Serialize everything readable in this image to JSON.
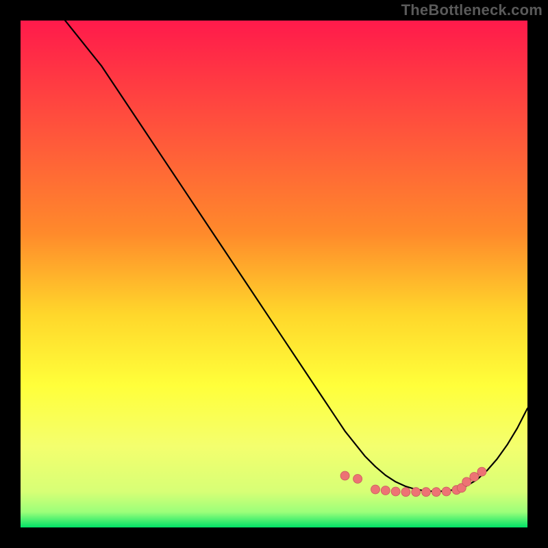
{
  "watermark": "TheBottleneck.com",
  "colors": {
    "gradient_top": "#ff1a4b",
    "gradient_mid1": "#ff8a2b",
    "gradient_mid2": "#ffd72b",
    "gradient_mid3": "#ffff3a",
    "gradient_mid4": "#f4ff6e",
    "gradient_bottom": "#00e267",
    "curve": "#000000",
    "marker_fill": "#ed7374",
    "marker_stroke": "#c55a5b",
    "black": "#000000"
  },
  "chart_data": {
    "type": "line",
    "title": "",
    "xlabel": "",
    "ylabel": "",
    "xlim": [
      0,
      100
    ],
    "ylim": [
      0,
      100
    ],
    "x": [
      0,
      4,
      8,
      12,
      16,
      20,
      24,
      28,
      32,
      36,
      40,
      44,
      48,
      52,
      56,
      60,
      62,
      64,
      66,
      68,
      70,
      72,
      74,
      76,
      78,
      80,
      82,
      84,
      86,
      88,
      90,
      92,
      94,
      96,
      98,
      100
    ],
    "values": [
      105,
      104,
      101,
      96,
      91,
      85,
      79,
      73,
      67,
      61,
      55,
      49,
      43,
      37,
      31,
      25,
      22,
      19,
      16.5,
      14,
      12,
      10.3,
      9,
      8.1,
      7.5,
      7.2,
      7.1,
      7.2,
      7.5,
      8.2,
      9.4,
      11.2,
      13.5,
      16.3,
      19.6,
      23.5
    ],
    "markers": {
      "x": [
        64,
        66.5,
        70,
        72,
        74,
        76,
        78,
        80,
        82,
        84,
        86,
        87,
        88,
        89.5,
        91
      ],
      "y": [
        10.2,
        9.6,
        7.5,
        7.3,
        7.1,
        7.0,
        7.0,
        7.0,
        7.0,
        7.1,
        7.4,
        7.8,
        9.0,
        10.0,
        11.0
      ]
    }
  }
}
